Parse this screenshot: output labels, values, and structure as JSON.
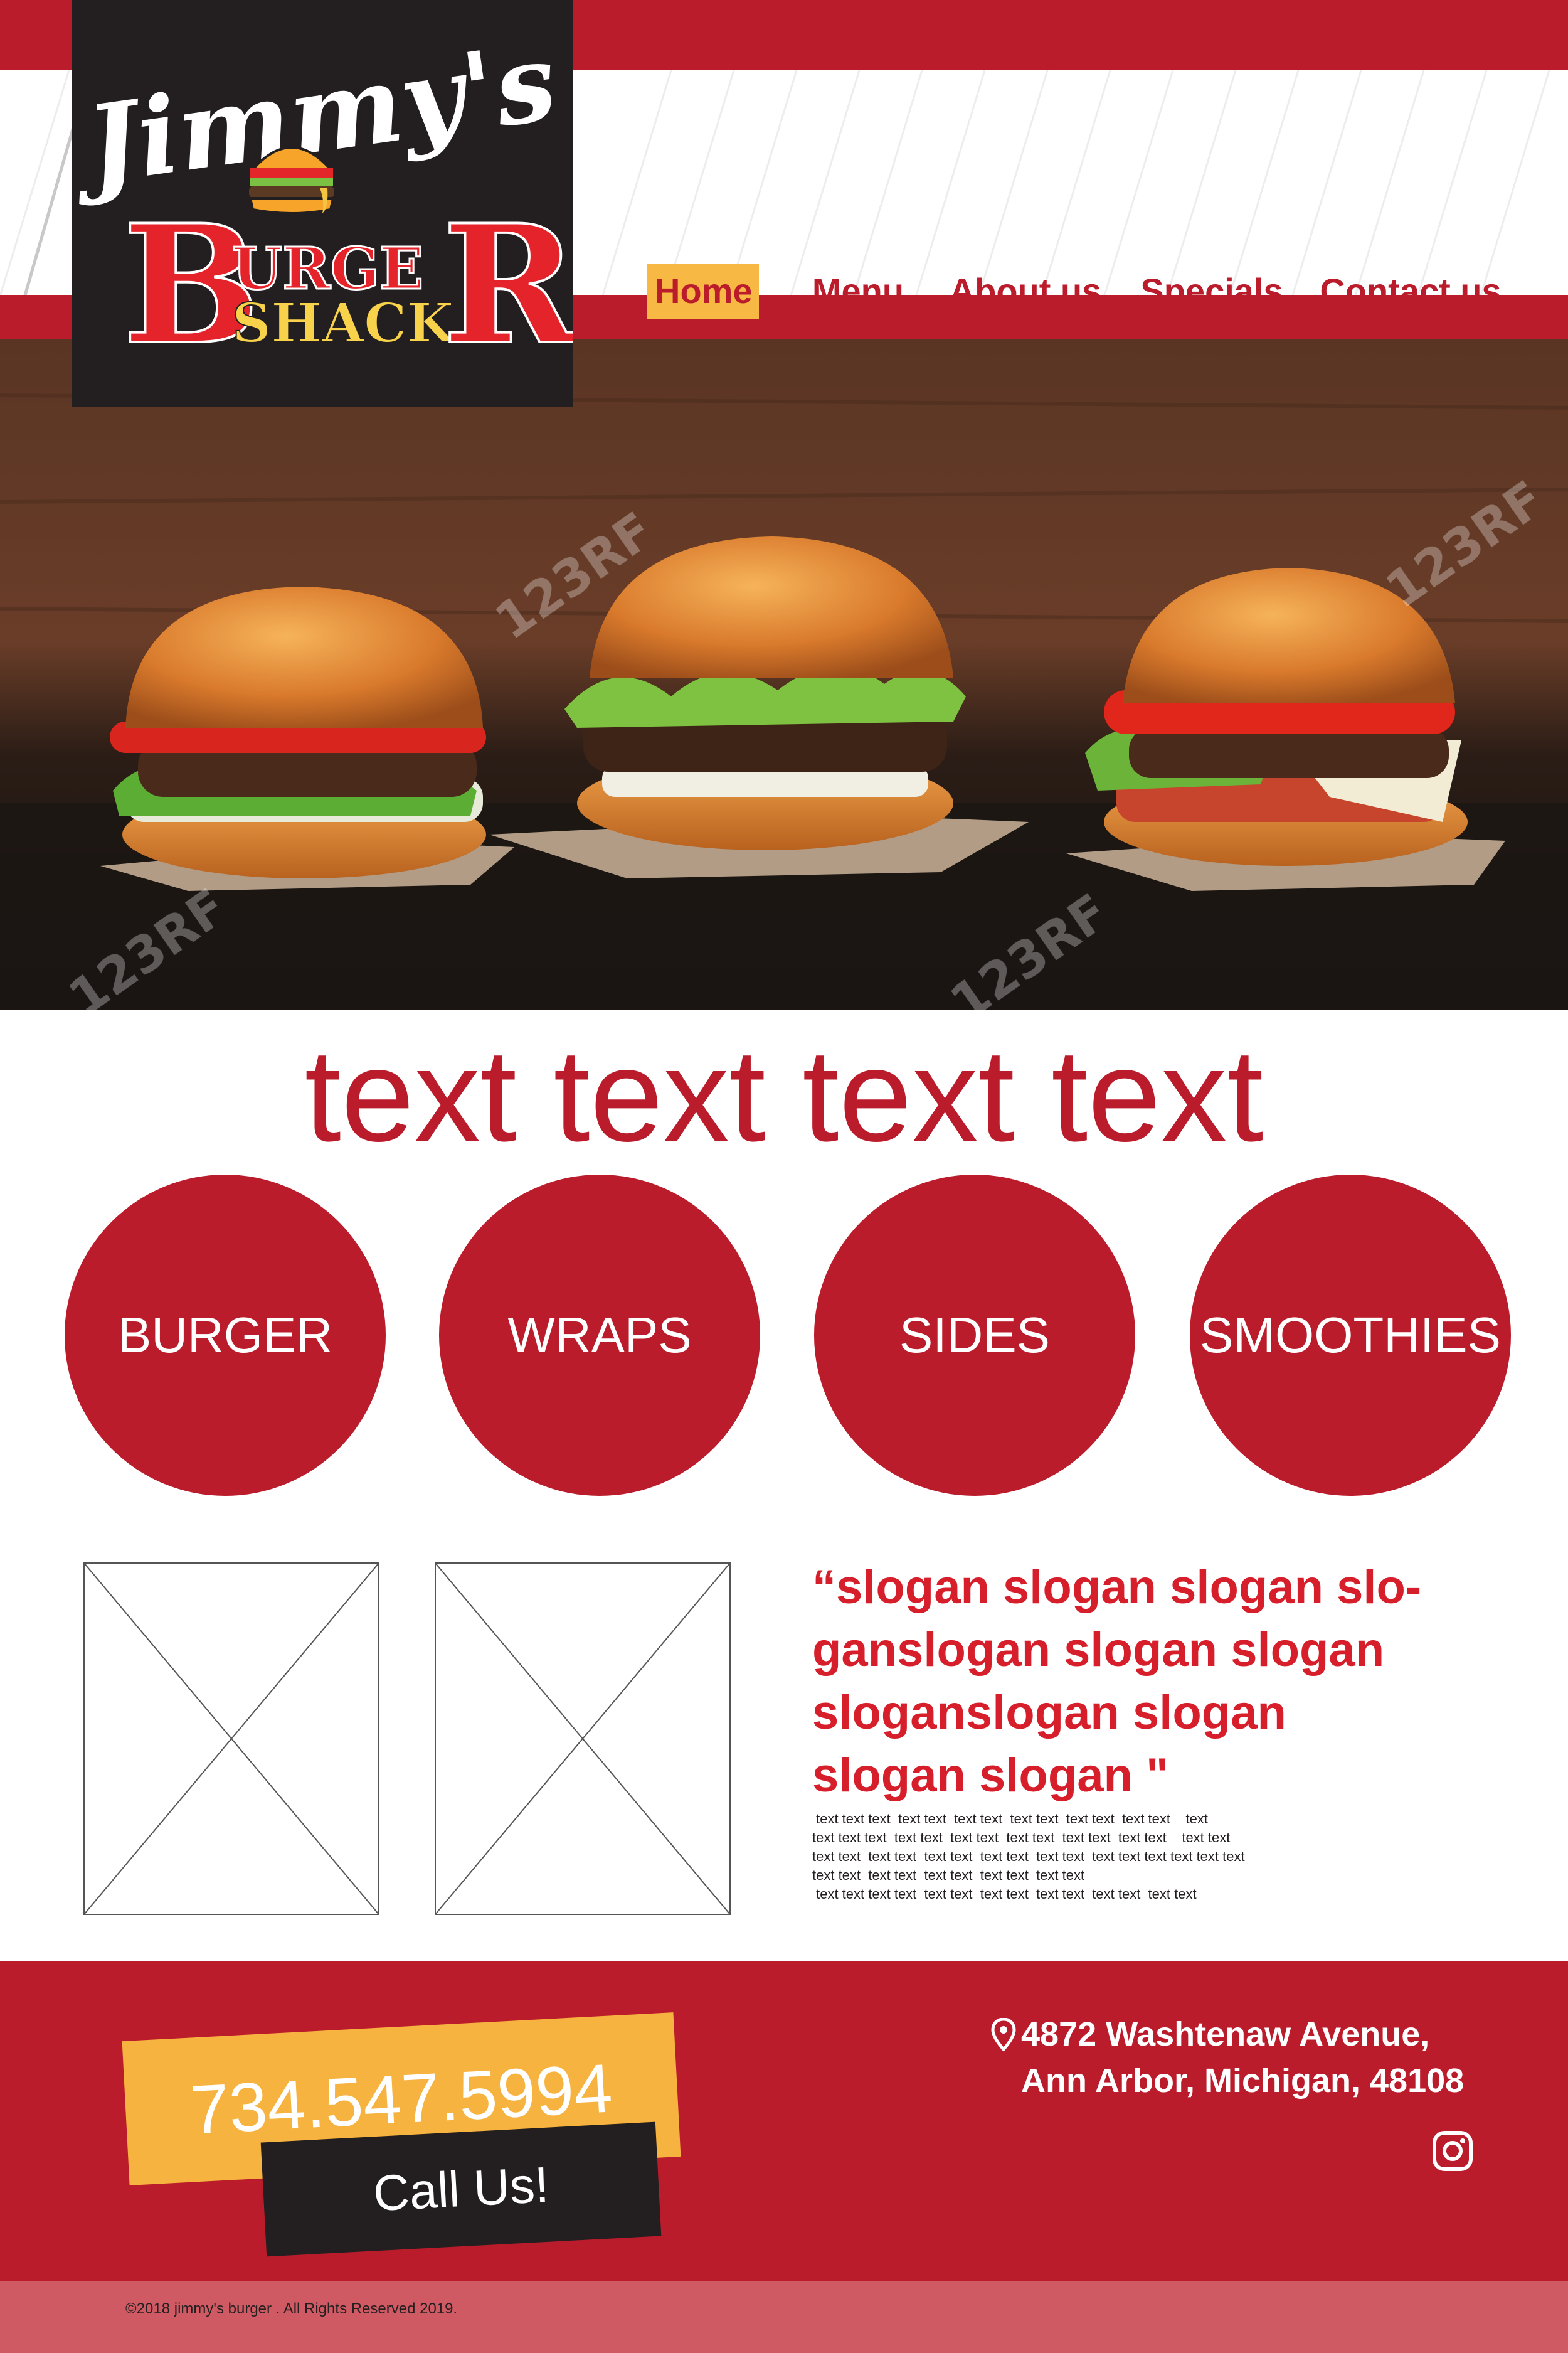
{
  "brand": {
    "script_name": "Jimmy's",
    "name_big_first": "B",
    "name_big_middle": "URGE",
    "name_big_last": "R",
    "name_shack": "SHACK"
  },
  "nav": {
    "items": [
      {
        "label": "Home",
        "active": true
      },
      {
        "label": "Menu",
        "active": false
      },
      {
        "label": "About us",
        "active": false
      },
      {
        "label": "Specials",
        "active": false
      },
      {
        "label": "Contact us",
        "active": false
      }
    ]
  },
  "hero": {
    "image": "three-burgers-on-wooden-table",
    "watermark": "123RF"
  },
  "headline": "text text text text",
  "categories": [
    {
      "label": "BURGER"
    },
    {
      "label": "WRAPS"
    },
    {
      "label": "SIDES"
    },
    {
      "label": "SMOOTHIES"
    }
  ],
  "slogan": {
    "lines": [
      "“slogan slogan slogan slo-",
      "ganslogan slogan slogan",
      "sloganslogan slogan",
      "slogan slogan  \""
    ]
  },
  "body_text": {
    "lines": [
      " text text text  text text  text text  text text  text text  text text    text",
      "text text text  text text  text text  text text  text text  text text    text text",
      "text text  text text  text text  text text  text text  text text text text text text",
      "text text  text text  text text  text text  text text",
      " text text text text  text text  text text  text text  text text  text text"
    ]
  },
  "contact": {
    "phone": "734.547.5994",
    "call_label": "Call Us!",
    "address_line1": "4872 Washtenaw Avenue,",
    "address_line2": "Ann Arbor, Michigan, 48108",
    "social_icon": "instagram-icon"
  },
  "footer": {
    "copyright": "©2018 jimmy's burger . All Rights Reserved 2019."
  },
  "colors": {
    "brand_red": "#bb1c2b",
    "accent_yellow": "#f7b844",
    "dark": "#231f20",
    "footer_pink": "#cf5a63"
  }
}
